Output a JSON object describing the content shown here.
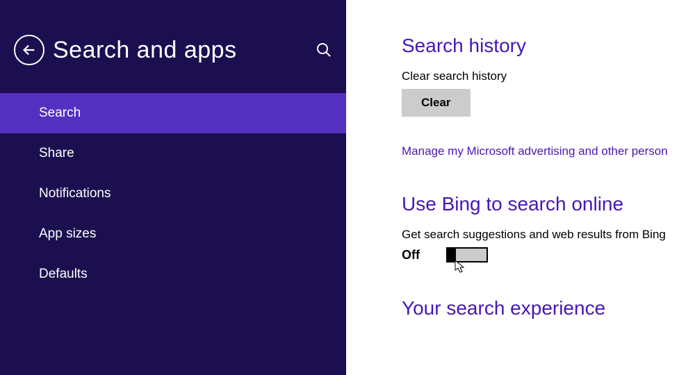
{
  "header": {
    "title": "Search and apps"
  },
  "sidebar": {
    "items": [
      {
        "label": "Search",
        "active": true
      },
      {
        "label": "Share",
        "active": false
      },
      {
        "label": "Notifications",
        "active": false
      },
      {
        "label": "App sizes",
        "active": false
      },
      {
        "label": "Defaults",
        "active": false
      }
    ]
  },
  "main": {
    "section1": {
      "heading": "Search history",
      "sub": "Clear search history",
      "button": "Clear",
      "link": "Manage my Microsoft advertising and other person"
    },
    "section2": {
      "heading": "Use Bing to search online",
      "sub": "Get search suggestions and web results from Bing",
      "toggle_state": "Off"
    },
    "section3": {
      "heading": "Your search experience"
    }
  }
}
